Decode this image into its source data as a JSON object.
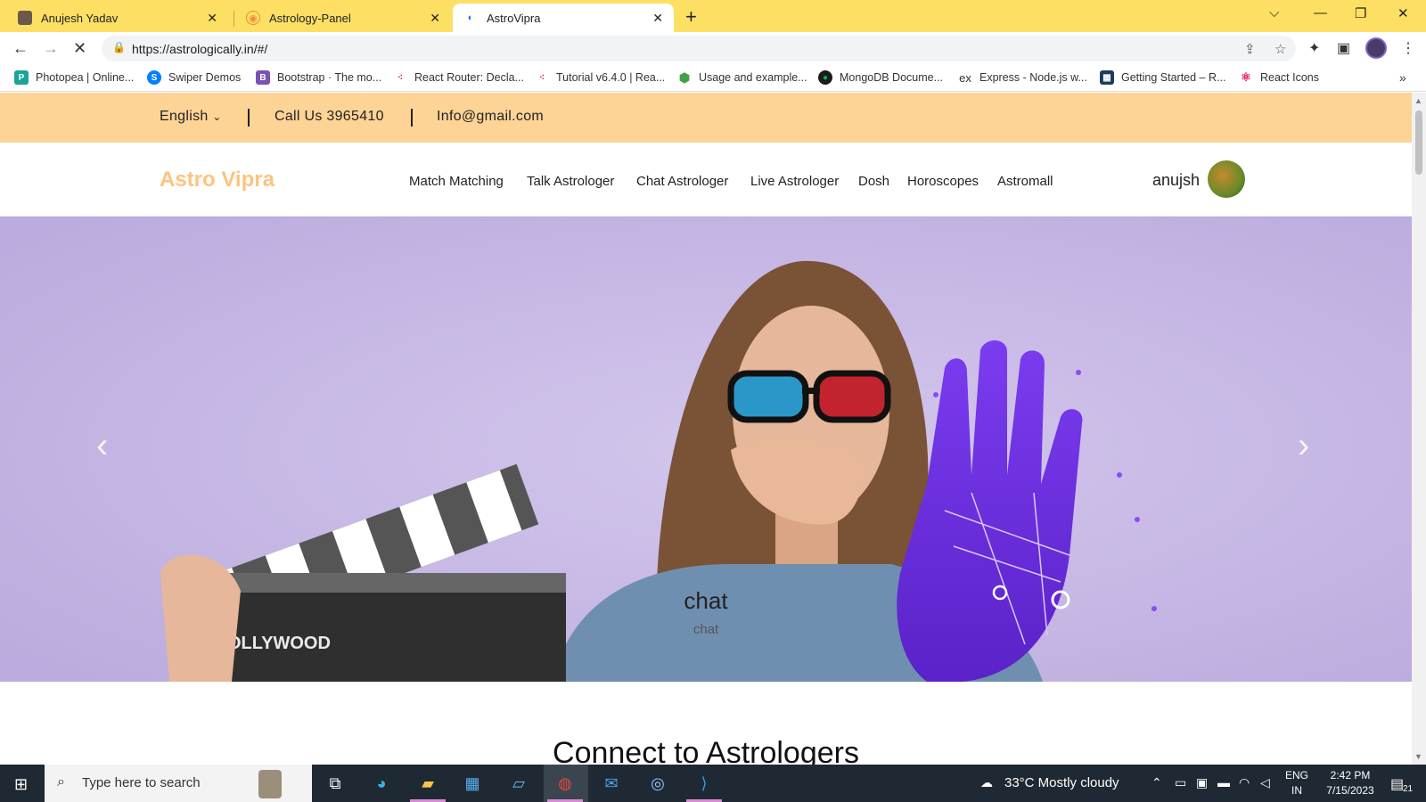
{
  "browser": {
    "tabs": [
      {
        "title": "Anujesh Yadav",
        "icon": "person-photo-icon"
      },
      {
        "title": "Astrology-Panel",
        "icon": "astrology-logo-icon"
      },
      {
        "title": "AstroVipra",
        "icon": "astrovipra-logo-icon",
        "active": true
      }
    ],
    "url": "https://astrologically.in/#/",
    "bookmarks": [
      {
        "label": "Photopea | Online...",
        "color": "#18a497"
      },
      {
        "label": "Swiper Demos",
        "color": "#0080ff"
      },
      {
        "label": "Bootstrap · The mo...",
        "color": "#7952b3"
      },
      {
        "label": "React Router: Decla...",
        "color": "#d0021b"
      },
      {
        "label": "Tutorial v6.4.0 | Rea...",
        "color": "#d0021b"
      },
      {
        "label": "Usage and example...",
        "color": "#43a047"
      },
      {
        "label": "MongoDB Docume...",
        "color": "#13aa52"
      },
      {
        "label": "Express - Node.js w...",
        "color": "#333333"
      },
      {
        "label": "Getting Started – R...",
        "color": "#1e3a5f"
      },
      {
        "label": "React Icons",
        "color": "#e91e63"
      }
    ],
    "bookmarks_more": "»"
  },
  "site": {
    "topbar": {
      "language": "English",
      "phone": "Call Us 3965410",
      "email": "Info@gmail.com"
    },
    "brand": "Astro Vipra",
    "menu": [
      "Match Matching",
      "Talk Astrologer",
      "Chat Astrologer",
      "Live Astrologer",
      "Dosh",
      "Horoscopes",
      "Astromall"
    ],
    "user": {
      "name": "anujsh"
    },
    "hero": {
      "caption_title": "chat",
      "caption_subtitle": "chat",
      "prev": "‹",
      "next": "›",
      "clapper_text": "OLLYWOOD"
    },
    "section_title": "Connect to Astrologers"
  },
  "taskbar": {
    "search_placeholder": "Type here to search",
    "weather": "33°C  Mostly cloudy",
    "lang": "ENG",
    "region": "IN",
    "time": "2:42 PM",
    "date": "7/15/2023",
    "notifications": "21"
  },
  "colors": {
    "tabbar": "#fde063",
    "topstrip": "#fed396",
    "brand": "#fdc37f",
    "hero_bg": "#c7b8e3"
  }
}
